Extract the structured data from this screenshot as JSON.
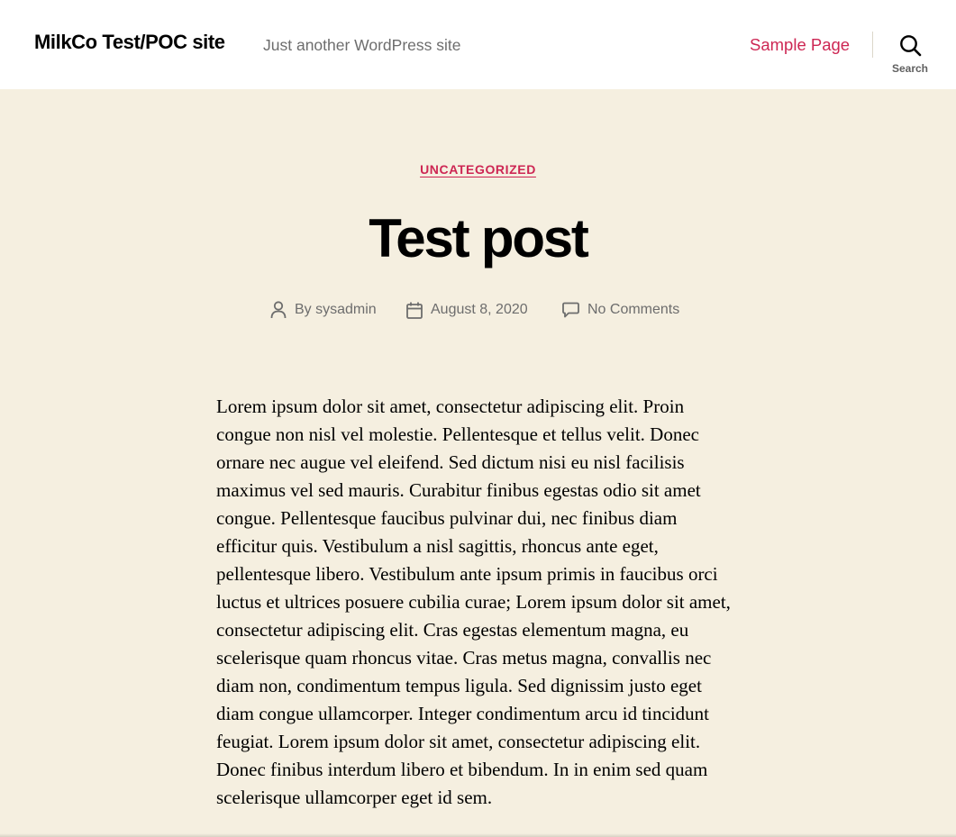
{
  "header": {
    "site_title": "MilkCo Test/POC site",
    "tagline": "Just another WordPress site",
    "nav": [
      {
        "label": "Sample Page"
      }
    ],
    "search_label": "Search",
    "search_icon": "search-icon"
  },
  "post": {
    "category": "UNCATEGORIZED",
    "title": "Test post",
    "meta": {
      "author_prefix": "By",
      "author": "sysadmin",
      "author_icon": "user-icon",
      "date": "August 8, 2020",
      "date_icon": "calendar-icon",
      "comments": "No Comments",
      "comments_icon": "comment-icon"
    },
    "body": "Lorem ipsum dolor sit amet, consectetur adipiscing elit. Proin congue non nisl vel molestie. Pellentesque et tellus velit. Donec ornare nec augue vel eleifend. Sed dictum nisi eu nisl facilisis maximus vel sed mauris. Curabitur finibus egestas odio sit amet congue. Pellentesque faucibus pulvinar dui, nec finibus diam efficitur quis. Vestibulum a nisl sagittis, rhoncus ante eget, pellentesque libero. Vestibulum ante ipsum primis in faucibus orci luctus et ultrices posuere cubilia curae; Lorem ipsum dolor sit amet, consectetur adipiscing elit. Cras egestas elementum magna, eu scelerisque quam rhoncus vitae. Cras metus magna, convallis nec diam non, condimentum tempus ligula. Sed dignissim justo eget diam congue ullamcorper. Integer condimentum arcu id tincidunt feugiat. Lorem ipsum dolor sit amet, consectetur adipiscing elit. Donec finibus interdum libero et bibendum. In in enim sed quam scelerisque ullamcorper eget id sem."
  },
  "colors": {
    "accent": "#cd2653",
    "page_background": "#f5efe0",
    "header_background": "#ffffff",
    "meta_text": "#6d6d6d"
  }
}
